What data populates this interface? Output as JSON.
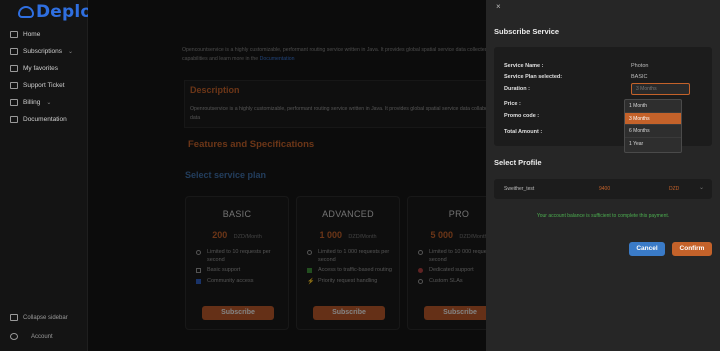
{
  "app": {
    "brand": "Deploily"
  },
  "sidebar": {
    "items": [
      {
        "label": "Home",
        "icon": "home-icon"
      },
      {
        "label": "Subscriptions",
        "icon": "layers-icon",
        "chevron": "⌄"
      },
      {
        "label": "My favorites",
        "icon": "heart-icon"
      },
      {
        "label": "Support Ticket",
        "icon": "ticket-icon"
      },
      {
        "label": "Billing",
        "icon": "card-icon",
        "chevron": "⌄"
      },
      {
        "label": "Documentation",
        "icon": "doc-icon"
      }
    ],
    "collapse_label": "Collapse sidebar",
    "account_label": "Account"
  },
  "main": {
    "intro_text": "Opencountservice is a highly customizable, performant routing service written in Java. It provides global spatial service data collected free geographic data.You can explore its capabilities and learn more in the",
    "intro_link": "Documentation",
    "description_title": "Description",
    "description_text": "Openroutservice is a highly customizable, performant routing service written in Java. It provides global spatial service data collaboratively collected free geographic data",
    "features_title": "Features and Specifications",
    "select_plan_title": "Select service plan",
    "plans": [
      {
        "name": "BASIC",
        "price": "200",
        "period": "DZD/Month",
        "features": [
          "Limited to 10 requests per second",
          "Basic support",
          "Community access"
        ],
        "button": "Subscribe"
      },
      {
        "name": "ADVANCED",
        "price": "1 000",
        "period": "DZD/Month",
        "features": [
          "Limited to 1 000 requests per second",
          "Access to traffic-based routing",
          "Priority request handling"
        ],
        "button": "Subscribe"
      },
      {
        "name": "PRO",
        "price": "5 000",
        "period": "DZD/Month",
        "features": [
          "Limited to 10 000 requests per second",
          "Dedicated support",
          "Custom SLAs"
        ],
        "button": "Subscribe"
      }
    ]
  },
  "modal": {
    "close": "×",
    "title": "Subscribe Service",
    "service_name_label": "Service Name :",
    "service_name_value": "Photon",
    "plan_label": "Service Plan selected:",
    "plan_value": "BASIC",
    "duration_label": "Duration :",
    "duration_placeholder": "3 Months",
    "price_label": "Price :",
    "promo_label": "Promo code :",
    "total_label": "Total Amount :",
    "duration_options": [
      "1 Month",
      "3 Months",
      "6 Months",
      "1 Year"
    ],
    "duration_selected_index": 1,
    "profile_title": "Select Profile",
    "profile_name": "Sweither_test",
    "profile_amount": "9400",
    "profile_balance": "DZD",
    "success_message": "Your account balance is sufficient to complete this payment.",
    "cancel_label": "Cancel",
    "confirm_label": "Confirm"
  },
  "colors": {
    "accent": "#c4622a",
    "brand": "#2f6fe0",
    "success": "#4caf50",
    "cancel": "#3a7bc8"
  }
}
